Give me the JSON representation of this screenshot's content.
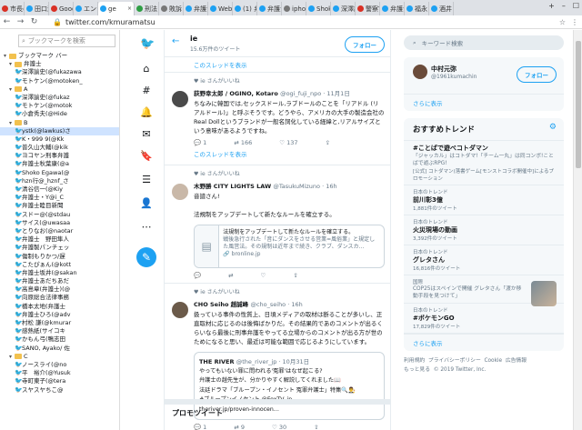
{
  "tabs": [
    {
      "label": "市長の"
    },
    {
      "label": "田口渉"
    },
    {
      "label": "Google"
    },
    {
      "label": "エンジ"
    },
    {
      "label": "ge",
      "active": true
    },
    {
      "label": "刑法"
    },
    {
      "label": "敗訴"
    },
    {
      "label": "弁護士"
    },
    {
      "label": "WebC"
    },
    {
      "label": "(1) 弁"
    },
    {
      "label": "弁護士"
    },
    {
      "label": "iphone"
    },
    {
      "label": "Shoko"
    },
    {
      "label": "深澤諭"
    },
    {
      "label": "警察官"
    },
    {
      "label": "弁護士"
    },
    {
      "label": "福永"
    },
    {
      "label": "酒井"
    }
  ],
  "address": {
    "url": "twitter.com/kmuramatsu"
  },
  "bookmarks": {
    "search_placeholder": "ブックマークを検索",
    "items": [
      {
        "label": "ブックマーク バー",
        "type": "folder",
        "toggle": "▾"
      },
      {
        "label": "弁護士",
        "type": "folder",
        "toggle": "▾"
      },
      {
        "label": "深澤諭史(@fukazawa",
        "type": "tw"
      },
      {
        "label": "モトケン(@motoken_",
        "type": "tw"
      },
      {
        "label": "A",
        "type": "folder",
        "toggle": "▾"
      },
      {
        "label": "深澤諭史(@fukaz",
        "type": "tw"
      },
      {
        "label": "モトケン(@motok",
        "type": "tw"
      },
      {
        "label": "小倉秀夫(@Hide",
        "type": "tw"
      },
      {
        "label": "B",
        "type": "folder",
        "toggle": "▾"
      },
      {
        "label": "ystk(@lawkus)さ",
        "type": "tw",
        "selected": true
      },
      {
        "label": "K・999 9(@Kk",
        "type": "tw"
      },
      {
        "label": "普久山大輔(@kik",
        "type": "tw"
      },
      {
        "label": "ヨコヤン刑事弁護",
        "type": "tw"
      },
      {
        "label": "弁護士秋葉康(@a",
        "type": "tw"
      },
      {
        "label": "Shoko Egawa(@",
        "type": "tw"
      },
      {
        "label": "hzn行@_hznf_さ",
        "type": "tw"
      },
      {
        "label": "清谷信一(@Kiy",
        "type": "tw"
      },
      {
        "label": "弁護士・Y@i_C",
        "type": "tw"
      },
      {
        "label": "弁護士睦目新聞",
        "type": "tw"
      },
      {
        "label": "スドー@(@stdau",
        "type": "tw"
      },
      {
        "label": "サイス(@uwasaa",
        "type": "tw"
      },
      {
        "label": "とりなお(@naotar",
        "type": "tw"
      },
      {
        "label": "弁護士　野田隼人",
        "type": "tw"
      },
      {
        "label": "弁護製パンチェッ",
        "type": "tw"
      },
      {
        "label": "傷制もりかつ/遅",
        "type": "tw"
      },
      {
        "label": "こたぴぁん(@kott",
        "type": "tw"
      },
      {
        "label": "弁護士坂井(@sakan",
        "type": "tw"
      },
      {
        "label": "弁護士あだちあだ",
        "type": "tw"
      },
      {
        "label": "高島章(弁護士)(@",
        "type": "tw"
      },
      {
        "label": "向原総合法律事務",
        "type": "tw"
      },
      {
        "label": "橋本太地(弁護士",
        "type": "tw"
      },
      {
        "label": "弁護士ひろ(@adv",
        "type": "tw"
      },
      {
        "label": "村松 謙(@kmurar",
        "type": "tw"
      },
      {
        "label": "感熱紙(サイコキ",
        "type": "tw"
      },
      {
        "label": "かもん弓(鴨志田",
        "type": "tw"
      },
      {
        "label": "SANO, Ayako/ 佐",
        "type": "tw"
      },
      {
        "label": "C",
        "type": "folder",
        "toggle": "▾"
      },
      {
        "label": "ノースライ(@no",
        "type": "tw"
      },
      {
        "label": "平　裕介(@Yusuk",
        "type": "tw"
      },
      {
        "label": "寺町東子(@tera",
        "type": "tw"
      },
      {
        "label": "スヤスヤちこ@",
        "type": "tw"
      }
    ]
  },
  "profile_header": {
    "title": "ie",
    "subtitle": "15.6万件のツイート",
    "follow_label": "フォロー"
  },
  "timeline": {
    "show_thread_1": "このスレッドを表示",
    "tweets": [
      {
        "liked_by": "ie さんがいいね",
        "name": "荻野幸太郎 / OGINO, Kotaro",
        "handle": "@ogi_fuji_npo · 11月1日",
        "body": "ちなみに韓国では,セックスドール,ラブドールのことを「リアドル (リアルドール)」と呼ぶそうです。どうやら、アメリカの大手の製造会社のReal Dollというブランドが一般名詞化している経緯と,リアルサイズという意味があるようですね。",
        "replies": "1",
        "retweets": "166",
        "likes": "137",
        "show_thread": "このスレッドを表示"
      },
      {
        "liked_by": "ie さんがいいね",
        "name": "木野勝 CITY LIGHTS LAW",
        "handle": "@TasukuMizuno · 16h",
        "reply_to": "音譜さん!",
        "body": "法規制をアップデートして新たなルールを確立する。",
        "card_title": "法規制をアップデートして新たなルールを確立する。",
        "card_text": "戦後急行された「音にダンスをさせる営業=風俗業」と規定した風営法。その規制は近年まで続き、クラブ、ダンスカ…",
        "card_domain": "bronline.jp",
        "replies": "",
        "retweets": "",
        "likes": ""
      },
      {
        "liked_by": "ie さんがいいね",
        "name": "CHO Seiho 趙誠峰",
        "handle": "@cho_seiho · 16h",
        "body": "扱っている事件の性質上、日頃メディアの取材は断ることが多いし、正直取材に応じるのは後悔ばかりだ。その結果的であのコメントが出るくらいなら最後に刑事弁護をやってる立場からのコメントが出る方が世のためになると思い、最近は可能な範囲で応じるようにしています。",
        "quote_name": "THE RIVER",
        "quote_handle": "@the_river_jp · 10月31日",
        "quote_lines": [
          "やってもいない罪に問われる'冤罪'はなぜ起こる?",
          "弁護士の趙先生が、分かりやすく解説してくれました📖",
          "法廷ドラマ「ブループン・イノセント 冤罪弁護士」特集🔍👨‍⚖️",
          "#ブループンイノセント @FoxTV_jp",
          "theriver.jp/proven-innocen…"
        ],
        "replies": "1",
        "retweets": "9",
        "likes": "30"
      }
    ],
    "promo_title": "プロモツイート"
  },
  "right": {
    "search_placeholder": "キーワード検索",
    "who": {
      "name": "中村元弥",
      "handle": "@1961kumachin",
      "follow_label": "フォロー",
      "more": "さらに表示"
    },
    "trends_title": "おすすめトレンド",
    "trends": [
      {
        "category": "",
        "name": "#ことばで遊べコトダマン",
        "desc": "「ジャッカル」はコトダマ!「チーム一丸」は同コンボ!ことばで遊ぶRPG!",
        "count": "[公式] コトダマン(落書ゲーム[モンストコラボ開催中]によるプロモーション"
      },
      {
        "category": "日本のトレンド",
        "name": "前川彰3億",
        "count": "1,881件のツイート"
      },
      {
        "category": "日本のトレンド",
        "name": "火災現場の動画",
        "count": "3,392件のツイート"
      },
      {
        "category": "日本のトレンド",
        "name": "グレタさん",
        "count": "16,816件のツイート"
      },
      {
        "category": "国際",
        "name": "",
        "desc": "COP25はスペインで開催 グレタさん「渡か移動手段を見つけて」",
        "thumb": true
      },
      {
        "category": "日本のトレンド",
        "name": "#ボケモンGO",
        "count": "17,829件のツイート"
      }
    ],
    "more": "さらに表示",
    "footer": [
      "利用規約",
      "プライバシーポリシー",
      "Cookie",
      "広告情報",
      "もっと見る",
      "© 2019 Twitter, Inc."
    ]
  }
}
